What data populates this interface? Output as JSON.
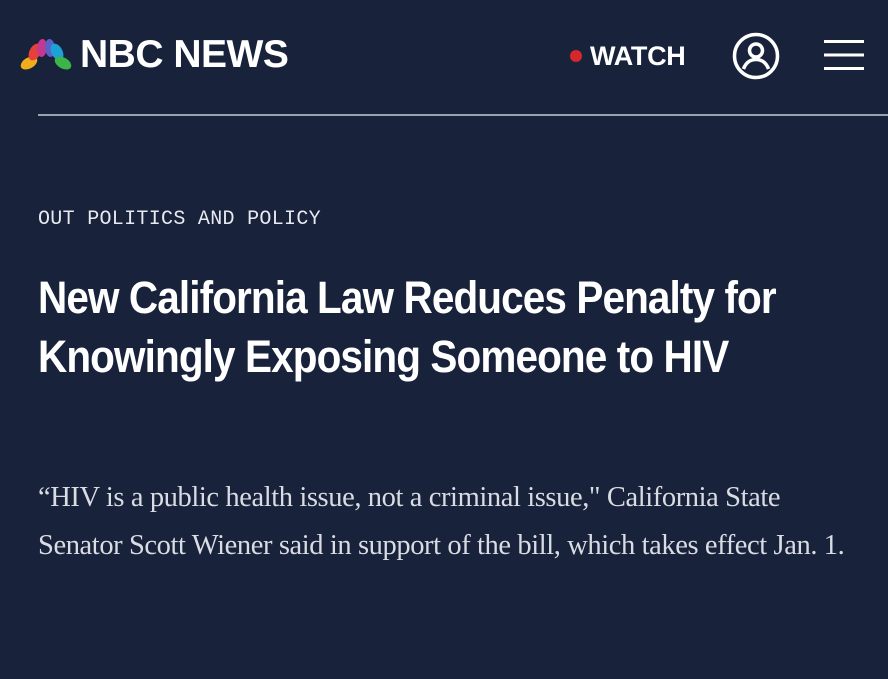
{
  "header": {
    "brand": "NBC NEWS",
    "logo_icon": "nbc-peacock-icon",
    "watch_label": "WATCH",
    "watch_indicator_color": "#d6282a",
    "account_icon": "user-account-icon",
    "menu_icon": "hamburger-menu-icon"
  },
  "article": {
    "section": "OUT POLITICS AND POLICY",
    "headline": "New California Law Reduces Penalty for Knowingly Exposing Someone to HIV",
    "dek": "“HIV is a public health issue, not a criminal issue,\" California State Senator Scott Wiener said in support of the bill, which takes effect Jan. 1."
  },
  "colors": {
    "background": "#18223b",
    "text": "#ffffff",
    "divider": "#9aa1b0"
  }
}
